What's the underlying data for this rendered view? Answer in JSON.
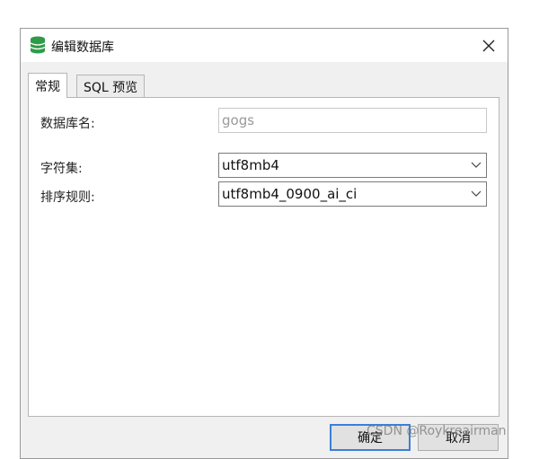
{
  "dialog": {
    "title": "编辑数据库",
    "title_icon": "database-icon",
    "close_icon": "close-icon"
  },
  "tabs": [
    {
      "label": "常规",
      "active": true
    },
    {
      "label": "SQL 预览",
      "active": false
    }
  ],
  "form": {
    "db_name_label": "数据库名:",
    "db_name_value": "gogs",
    "charset_label": "字符集:",
    "charset_value": "utf8mb4",
    "collation_label": "排序规则:",
    "collation_value": "utf8mb4_0900_ai_ci"
  },
  "buttons": {
    "ok_label": "确定",
    "cancel_label": "取消"
  },
  "watermark": "CSDN @Roykreairman",
  "colors": {
    "icon_green": "#2e9b48",
    "default_button_border": "#3c7fd6"
  }
}
